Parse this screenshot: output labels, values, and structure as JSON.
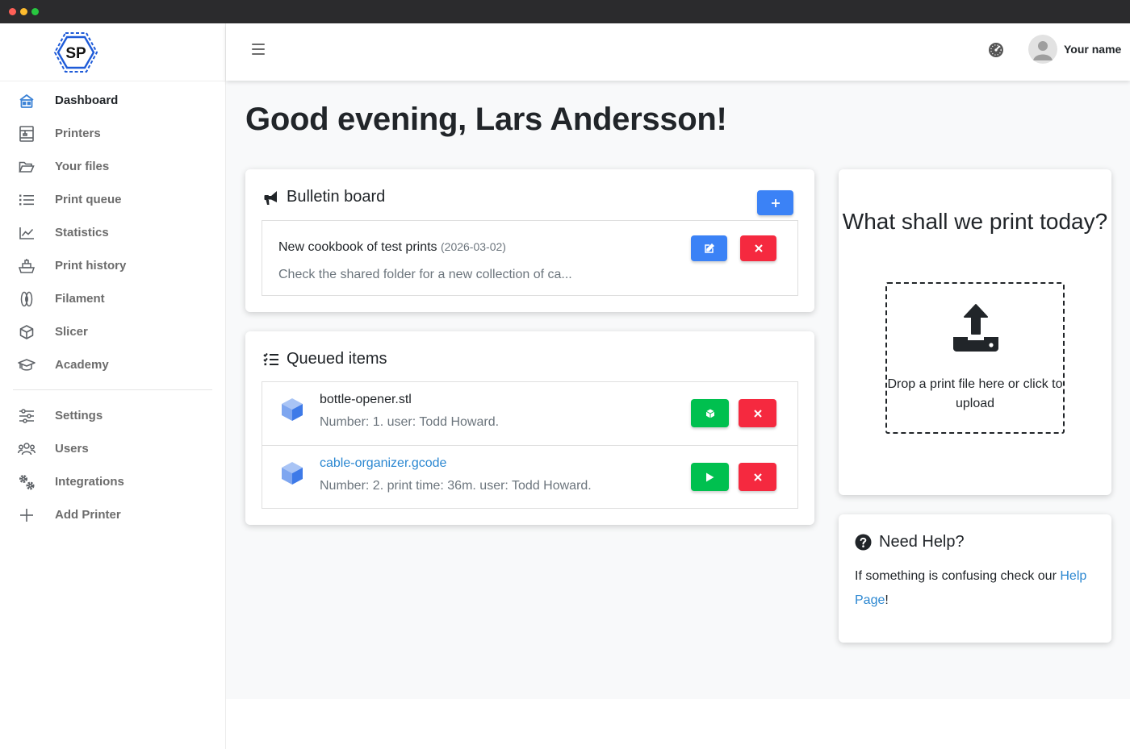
{
  "window": {
    "controls": [
      "close",
      "minimize",
      "maximize"
    ]
  },
  "brand": {
    "logo_text": "SP",
    "accent": "#1e5bd8"
  },
  "sidebar": {
    "items": [
      {
        "label": "Dashboard",
        "icon": "dashboard-icon",
        "active": true
      },
      {
        "label": "Printers",
        "icon": "printer-icon"
      },
      {
        "label": "Your files",
        "icon": "folder-icon"
      },
      {
        "label": "Print queue",
        "icon": "list-icon"
      },
      {
        "label": "Statistics",
        "icon": "chart-line-icon"
      },
      {
        "label": "Print history",
        "icon": "history-icon"
      },
      {
        "label": "Filament",
        "icon": "filament-icon"
      },
      {
        "label": "Slicer",
        "icon": "cube-icon"
      },
      {
        "label": "Academy",
        "icon": "graduation-cap-icon"
      }
    ],
    "bottom_items": [
      {
        "label": "Settings",
        "icon": "sliders-icon"
      },
      {
        "label": "Users",
        "icon": "users-icon"
      },
      {
        "label": "Integrations",
        "icon": "gears-icon"
      },
      {
        "label": "Add Printer",
        "icon": "plus-icon"
      }
    ]
  },
  "topbar": {
    "user_name": "Your name"
  },
  "main": {
    "greeting": "Good evening, Lars Andersson!",
    "bulletin": {
      "title": "Bulletin board",
      "items": [
        {
          "title": "New cookbook of test prints",
          "date": "(2026-03-02)",
          "text": "Check the shared folder for a new collection of ca..."
        }
      ]
    },
    "queue": {
      "title": "Queued items",
      "items": [
        {
          "name": "bottle-opener.stl",
          "meta": "Number: 1. user: Todd Howard.",
          "action": "slice"
        },
        {
          "name": "cable-organizer.gcode",
          "meta": "Number: 2. print time: 36m. user: Todd Howard.",
          "action": "play"
        }
      ]
    },
    "upload": {
      "title": "What shall we print today?",
      "dropzone_text": "Drop a print file here or click to upload"
    },
    "help": {
      "title": "Need Help?",
      "text_before": "If something is confusing check our ",
      "link_text": "Help Page",
      "text_after": "!"
    }
  },
  "colors": {
    "primary": "#3b82f6",
    "danger": "#f5293f",
    "success": "#00c04f",
    "link": "#2b87d1"
  }
}
